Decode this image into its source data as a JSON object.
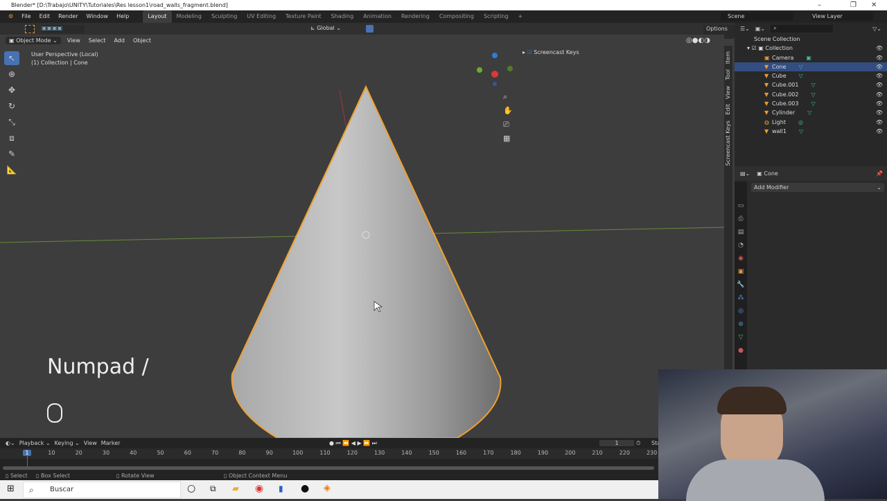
{
  "window": {
    "title": "Blender* [D:\\Trabajo\\UNITY\\Tutoriales\\Res lesson1\\road_walls_fragment.blend]",
    "minimize": "–",
    "restore": "❐",
    "close": "✕"
  },
  "menu": [
    "File",
    "Edit",
    "Render",
    "Window",
    "Help"
  ],
  "workspaces": [
    "Layout",
    "Modeling",
    "Sculpting",
    "UV Editing",
    "Texture Paint",
    "Shading",
    "Animation",
    "Rendering",
    "Compositing",
    "Scripting",
    "+"
  ],
  "scene": {
    "label": "Scene",
    "view_layer": "View Layer"
  },
  "tool_header": {
    "orientation": "Global",
    "options": "Options"
  },
  "viewport_header": {
    "mode": "Object Mode",
    "menus": [
      "View",
      "Select",
      "Add",
      "Object"
    ]
  },
  "viewport": {
    "perspective": "User Perspective (Local)",
    "collection": "(1) Collection | Cone",
    "screencast_keys": "Screencast Keys",
    "side_tabs": [
      "Item",
      "Tool",
      "View",
      "Edit",
      "Screencast Keys"
    ],
    "key_display": "Numpad /"
  },
  "outliner": {
    "root": "Scene Collection",
    "collection": "Collection",
    "items": [
      {
        "name": "Camera",
        "type": "camera",
        "selected": false
      },
      {
        "name": "Cone",
        "type": "mesh",
        "selected": true
      },
      {
        "name": "Cube",
        "type": "mesh",
        "selected": false
      },
      {
        "name": "Cube.001",
        "type": "mesh",
        "selected": false
      },
      {
        "name": "Cube.002",
        "type": "mesh",
        "selected": false
      },
      {
        "name": "Cube.003",
        "type": "mesh",
        "selected": false
      },
      {
        "name": "Cylinder",
        "type": "mesh",
        "selected": false
      },
      {
        "name": "Light",
        "type": "light",
        "selected": false
      },
      {
        "name": "wall1",
        "type": "mesh",
        "selected": false
      }
    ]
  },
  "properties": {
    "object": "Cone",
    "add_modifier": "Add Modifier"
  },
  "timeline": {
    "menus": [
      "Playback",
      "Keying",
      "View",
      "Marker"
    ],
    "current_frame": "1",
    "start_label": "Sta",
    "ticks": [
      "1",
      "10",
      "20",
      "30",
      "40",
      "50",
      "60",
      "70",
      "80",
      "90",
      "100",
      "110",
      "120",
      "130",
      "140",
      "150",
      "160",
      "170",
      "180",
      "190",
      "200",
      "210",
      "220",
      "230"
    ]
  },
  "status": {
    "select": "Select",
    "box_select": "Box Select",
    "rotate": "Rotate View",
    "context": "Object Context Menu"
  },
  "taskbar": {
    "search": "Buscar"
  },
  "colors": {
    "accent": "#4772b3",
    "selection_outline": "#f0a030",
    "mesh_data": "#3fbf8f"
  }
}
